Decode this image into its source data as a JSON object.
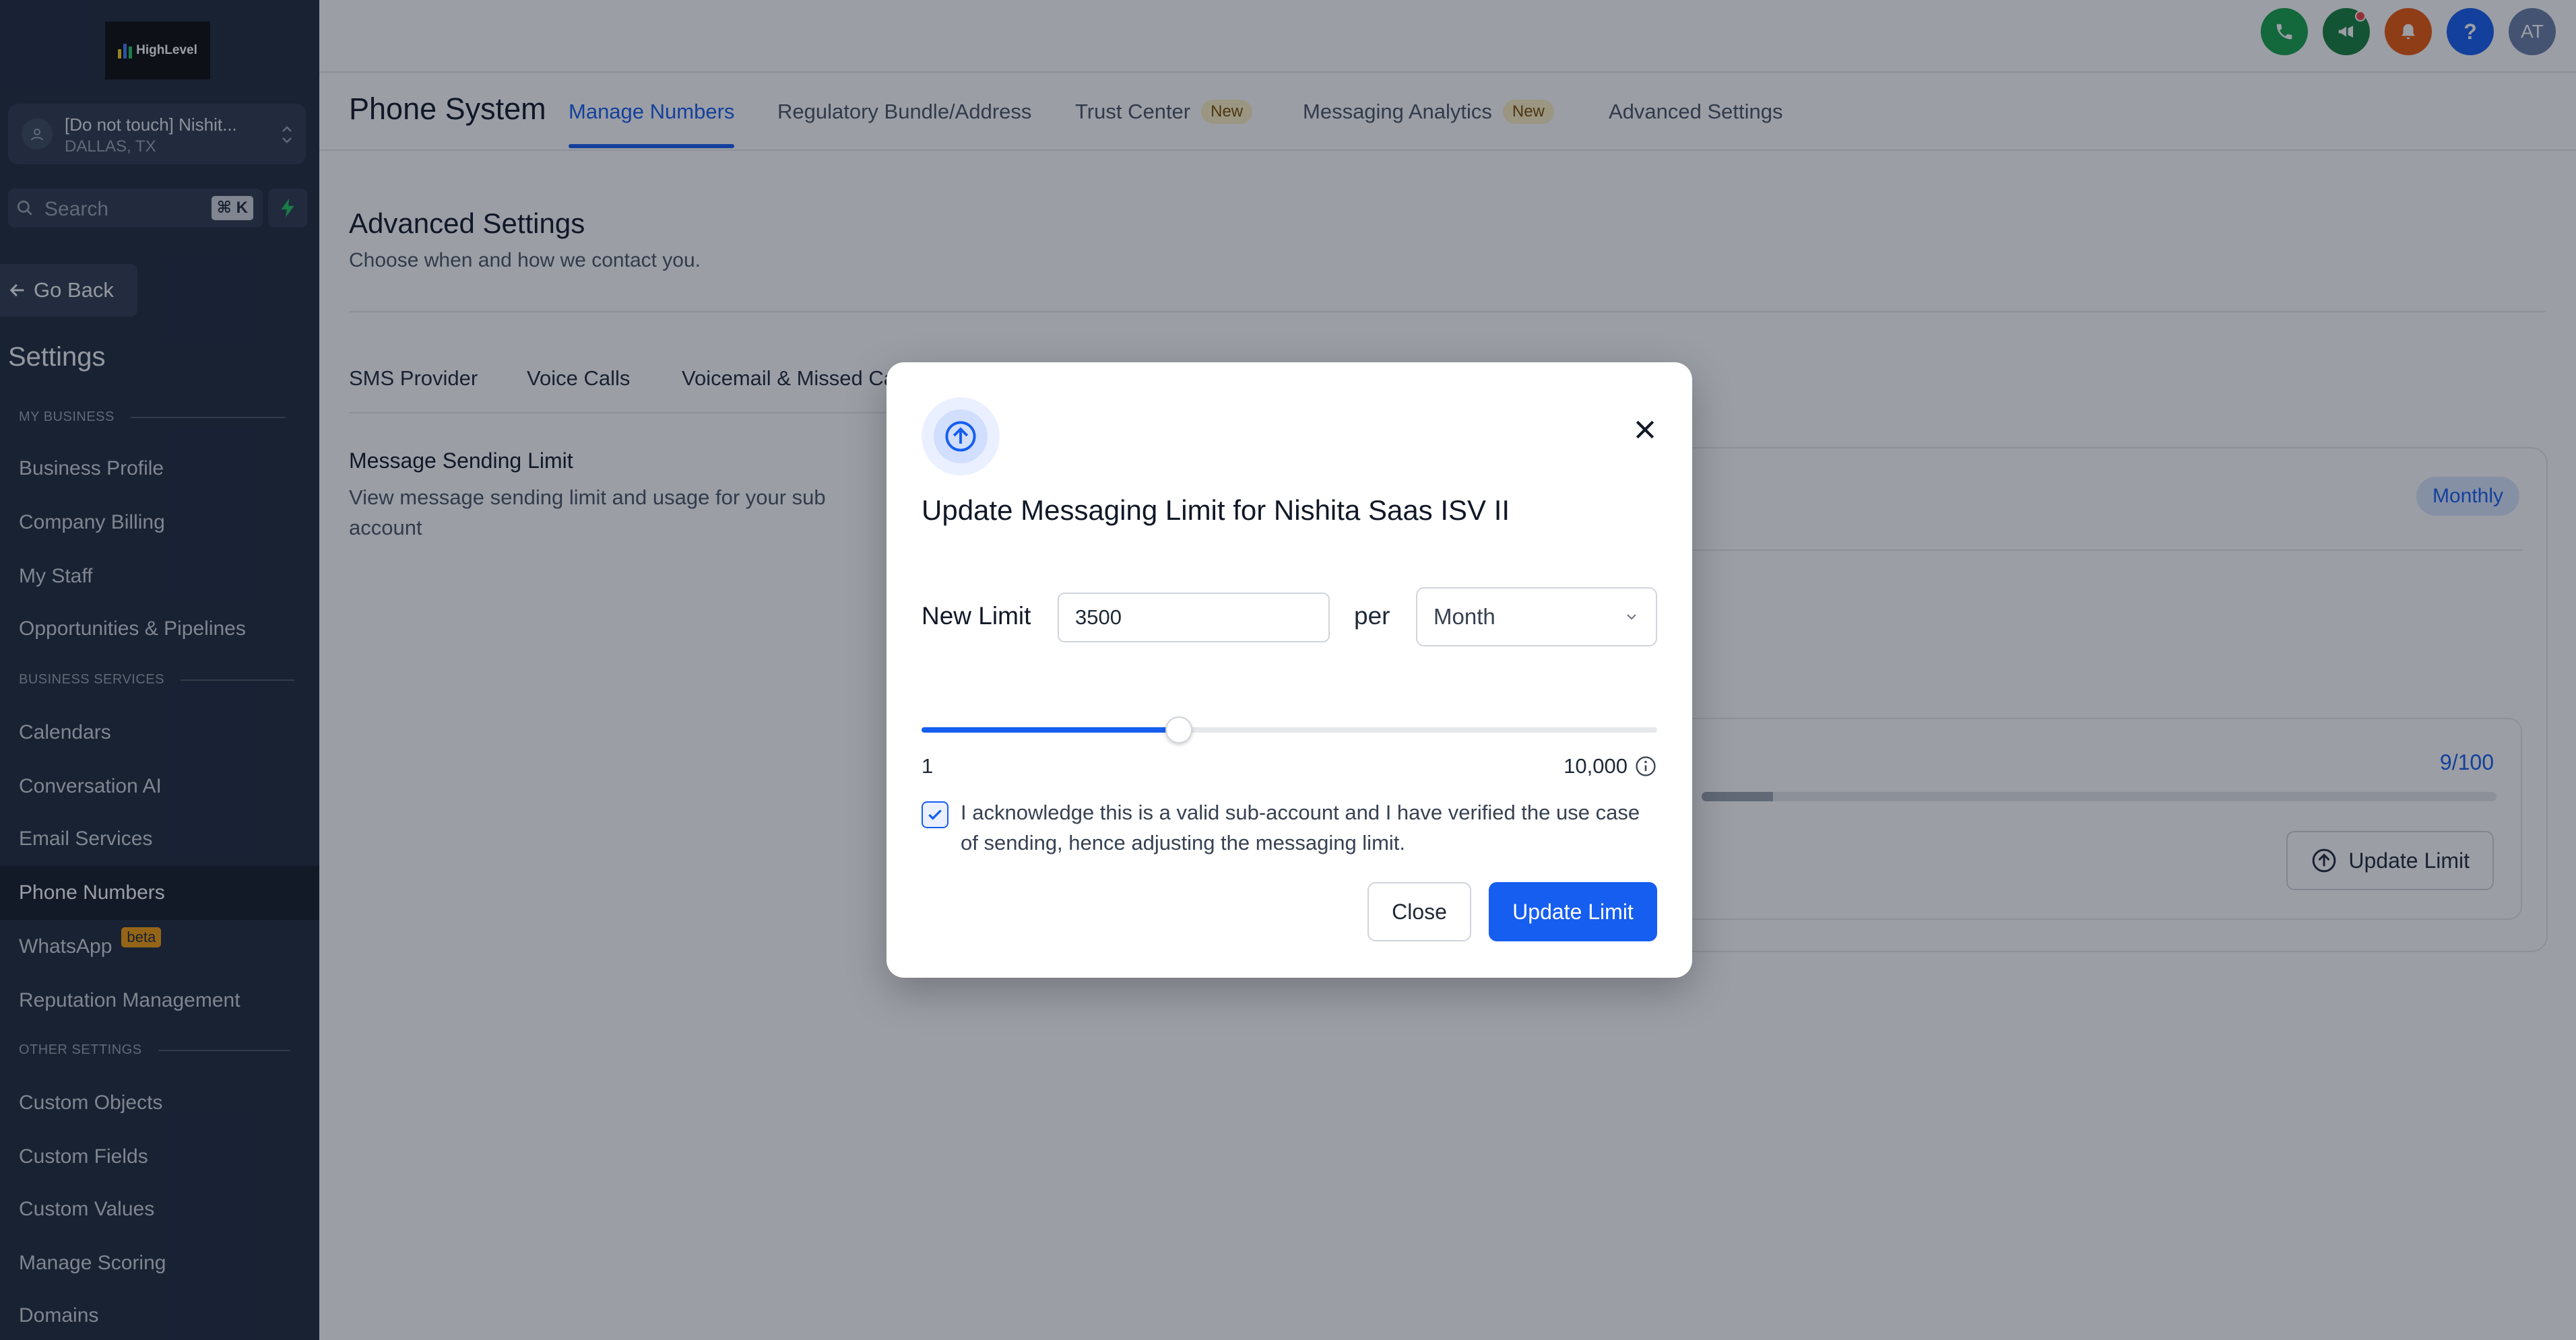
{
  "sidebar": {
    "logo_text": "HighLevel",
    "account": {
      "name": "[Do not touch] Nishit...",
      "location": "DALLAS, TX"
    },
    "search": {
      "placeholder": "Search",
      "shortcut": "⌘ K"
    },
    "go_back": "Go Back",
    "settings_title": "Settings",
    "sections": [
      {
        "label": "MY BUSINESS",
        "items": [
          "Business Profile",
          "Company Billing",
          "My Staff",
          "Opportunities & Pipelines"
        ]
      },
      {
        "label": "BUSINESS SERVICES",
        "items": [
          "Calendars",
          "Conversation AI",
          "Email Services",
          "Phone Numbers",
          "WhatsApp",
          "Reputation Management"
        ]
      },
      {
        "label": "OTHER SETTINGS",
        "items": [
          "Custom Objects",
          "Custom Fields",
          "Custom Values",
          "Manage Scoring",
          "Domains"
        ]
      }
    ],
    "active_item": "Phone Numbers",
    "whatsapp_badge": "beta"
  },
  "topbar": {
    "icons": [
      {
        "name": "phone-icon",
        "color": "#16a34a"
      },
      {
        "name": "megaphone-icon",
        "color": "#15803d"
      },
      {
        "name": "bell-icon",
        "color": "#ea580c"
      },
      {
        "name": "help-icon",
        "color": "#155eef",
        "glyph": "?"
      },
      {
        "name": "avatar",
        "color": "#6b7fa8",
        "glyph": "AT"
      }
    ]
  },
  "tabsbar": {
    "title": "Phone System",
    "tabs": [
      {
        "label": "Manage Numbers",
        "active": true
      },
      {
        "label": "Regulatory Bundle/Address"
      },
      {
        "label": "Trust Center",
        "badge": "New"
      },
      {
        "label": "Messaging Analytics",
        "badge": "New"
      },
      {
        "label": "Advanced Settings"
      }
    ]
  },
  "main": {
    "title": "Advanced Settings",
    "subtitle": "Choose when and how we contact you.",
    "subtabs": [
      "SMS Provider",
      "Voice Calls",
      "Voicemail & Missed Ca"
    ],
    "section_title": "Message Sending Limit",
    "section_desc": "View message sending limit and usage for your sub account",
    "card": {
      "period_badge": "Monthly",
      "usage": "9/100",
      "usage_fraction": 0.09,
      "update_button": "Update Limit"
    }
  },
  "modal": {
    "title": "Update Messaging Limit for Nishita Saas ISV II",
    "new_limit_label": "New Limit",
    "new_limit_value": "3500",
    "per_label": "per",
    "period": "Month",
    "slider": {
      "min_label": "1",
      "max_label": "10,000",
      "value": 3500,
      "min": 1,
      "max": 10000
    },
    "acknowledged": true,
    "acknowledge_text": "I acknowledge this is a valid sub-account and I have verified the use case of sending, hence adjusting the messaging limit.",
    "close_button": "Close",
    "update_button": "Update Limit"
  },
  "colors": {
    "primary": "#155eef",
    "sidebar": "#1e2a3c",
    "badge_new": "#fdf1c3"
  }
}
